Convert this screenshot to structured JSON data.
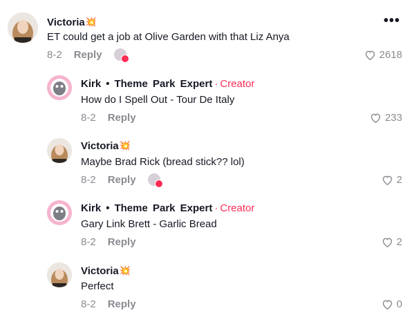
{
  "comments": [
    {
      "username": "Victoria",
      "emoji": "💥",
      "text": "ET could get a job at Olive Garden with that Liz Anya",
      "date": "8-2",
      "reply": "Reply",
      "likes": "2618",
      "more": "•••",
      "creator_liked": true
    },
    {
      "username": "Kirk",
      "dot": "•",
      "subtitle": "Theme Park Expert",
      "sep": "·",
      "badge": "Creator",
      "text": "How do I Spell Out - Tour De Italy",
      "date": "8-2",
      "reply": "Reply",
      "likes": "233"
    },
    {
      "username": "Victoria",
      "emoji": "💥",
      "text": "Maybe Brad Rick (bread stick?? lol)",
      "date": "8-2",
      "reply": "Reply",
      "likes": "2",
      "creator_liked": true
    },
    {
      "username": "Kirk",
      "dot": "•",
      "subtitle": "Theme Park Expert",
      "sep": "·",
      "badge": "Creator",
      "text": "Gary Link Brett - Garlic Bread",
      "date": "8-2",
      "reply": "Reply",
      "likes": "2"
    },
    {
      "username": "Victoria",
      "emoji": "💥",
      "text": "Perfect",
      "date": "8-2",
      "reply": "Reply",
      "likes": "0"
    }
  ],
  "colors": {
    "accent": "#fe2c55",
    "muted": "#8a8b91",
    "text": "#161823"
  },
  "icons": {
    "like": "heart-outline-icon",
    "more": "more-horizontal-icon"
  }
}
